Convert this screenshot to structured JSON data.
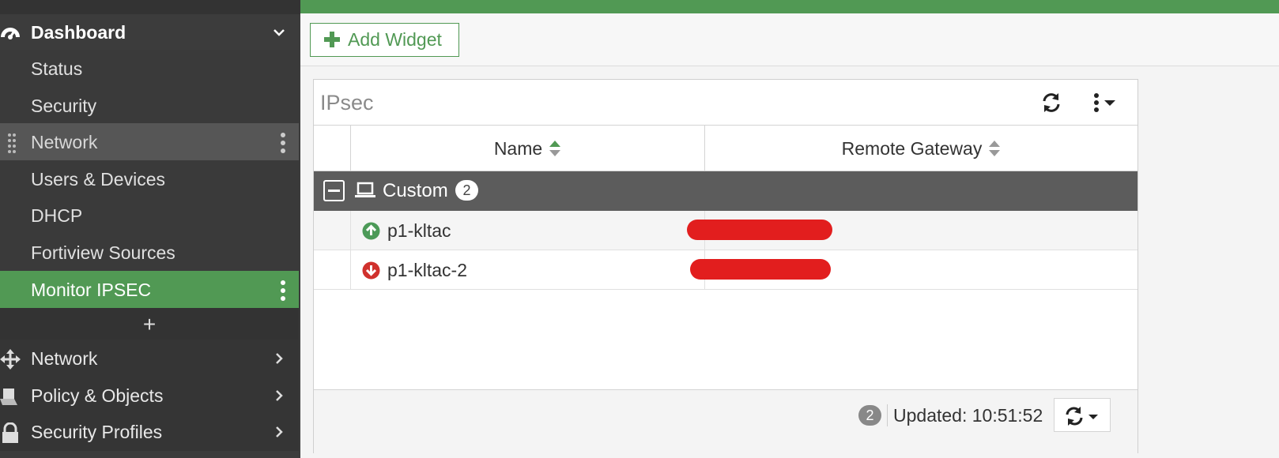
{
  "sidebar": {
    "dashboard": {
      "label": "Dashboard",
      "icon": "gauge-icon",
      "expanded": true
    },
    "sub_items": [
      {
        "label": "Status"
      },
      {
        "label": "Security"
      },
      {
        "label": "Network"
      },
      {
        "label": "Users & Devices"
      },
      {
        "label": "DHCP"
      },
      {
        "label": "Fortiview Sources"
      },
      {
        "label": "Monitor IPSEC",
        "active": true
      }
    ],
    "add_label": "+",
    "main_items": [
      {
        "label": "Network",
        "icon": "move-arrows-icon"
      },
      {
        "label": "Policy & Objects",
        "icon": "policy-icon"
      },
      {
        "label": "Security Profiles",
        "icon": "lock-icon"
      }
    ]
  },
  "toolbar": {
    "add_widget_label": "Add Widget"
  },
  "widget": {
    "title": "IPsec",
    "columns": [
      "Name",
      "Remote Gateway"
    ],
    "group": {
      "name": "Custom",
      "count": "2"
    },
    "rows": [
      {
        "name": "p1-kltac",
        "status": "up",
        "remote_gateway": "[redacted]"
      },
      {
        "name": "p1-kltac-2",
        "status": "down",
        "remote_gateway": "[redacted]"
      }
    ],
    "footer": {
      "count": "2",
      "updated": "Updated: 10:51:52"
    }
  },
  "colors": {
    "accent": "#519954",
    "sidebar_bg": "#3c3c3c",
    "status_up": "#4c9a58",
    "status_down": "#d0312d",
    "redaction": "#e21e1e"
  }
}
